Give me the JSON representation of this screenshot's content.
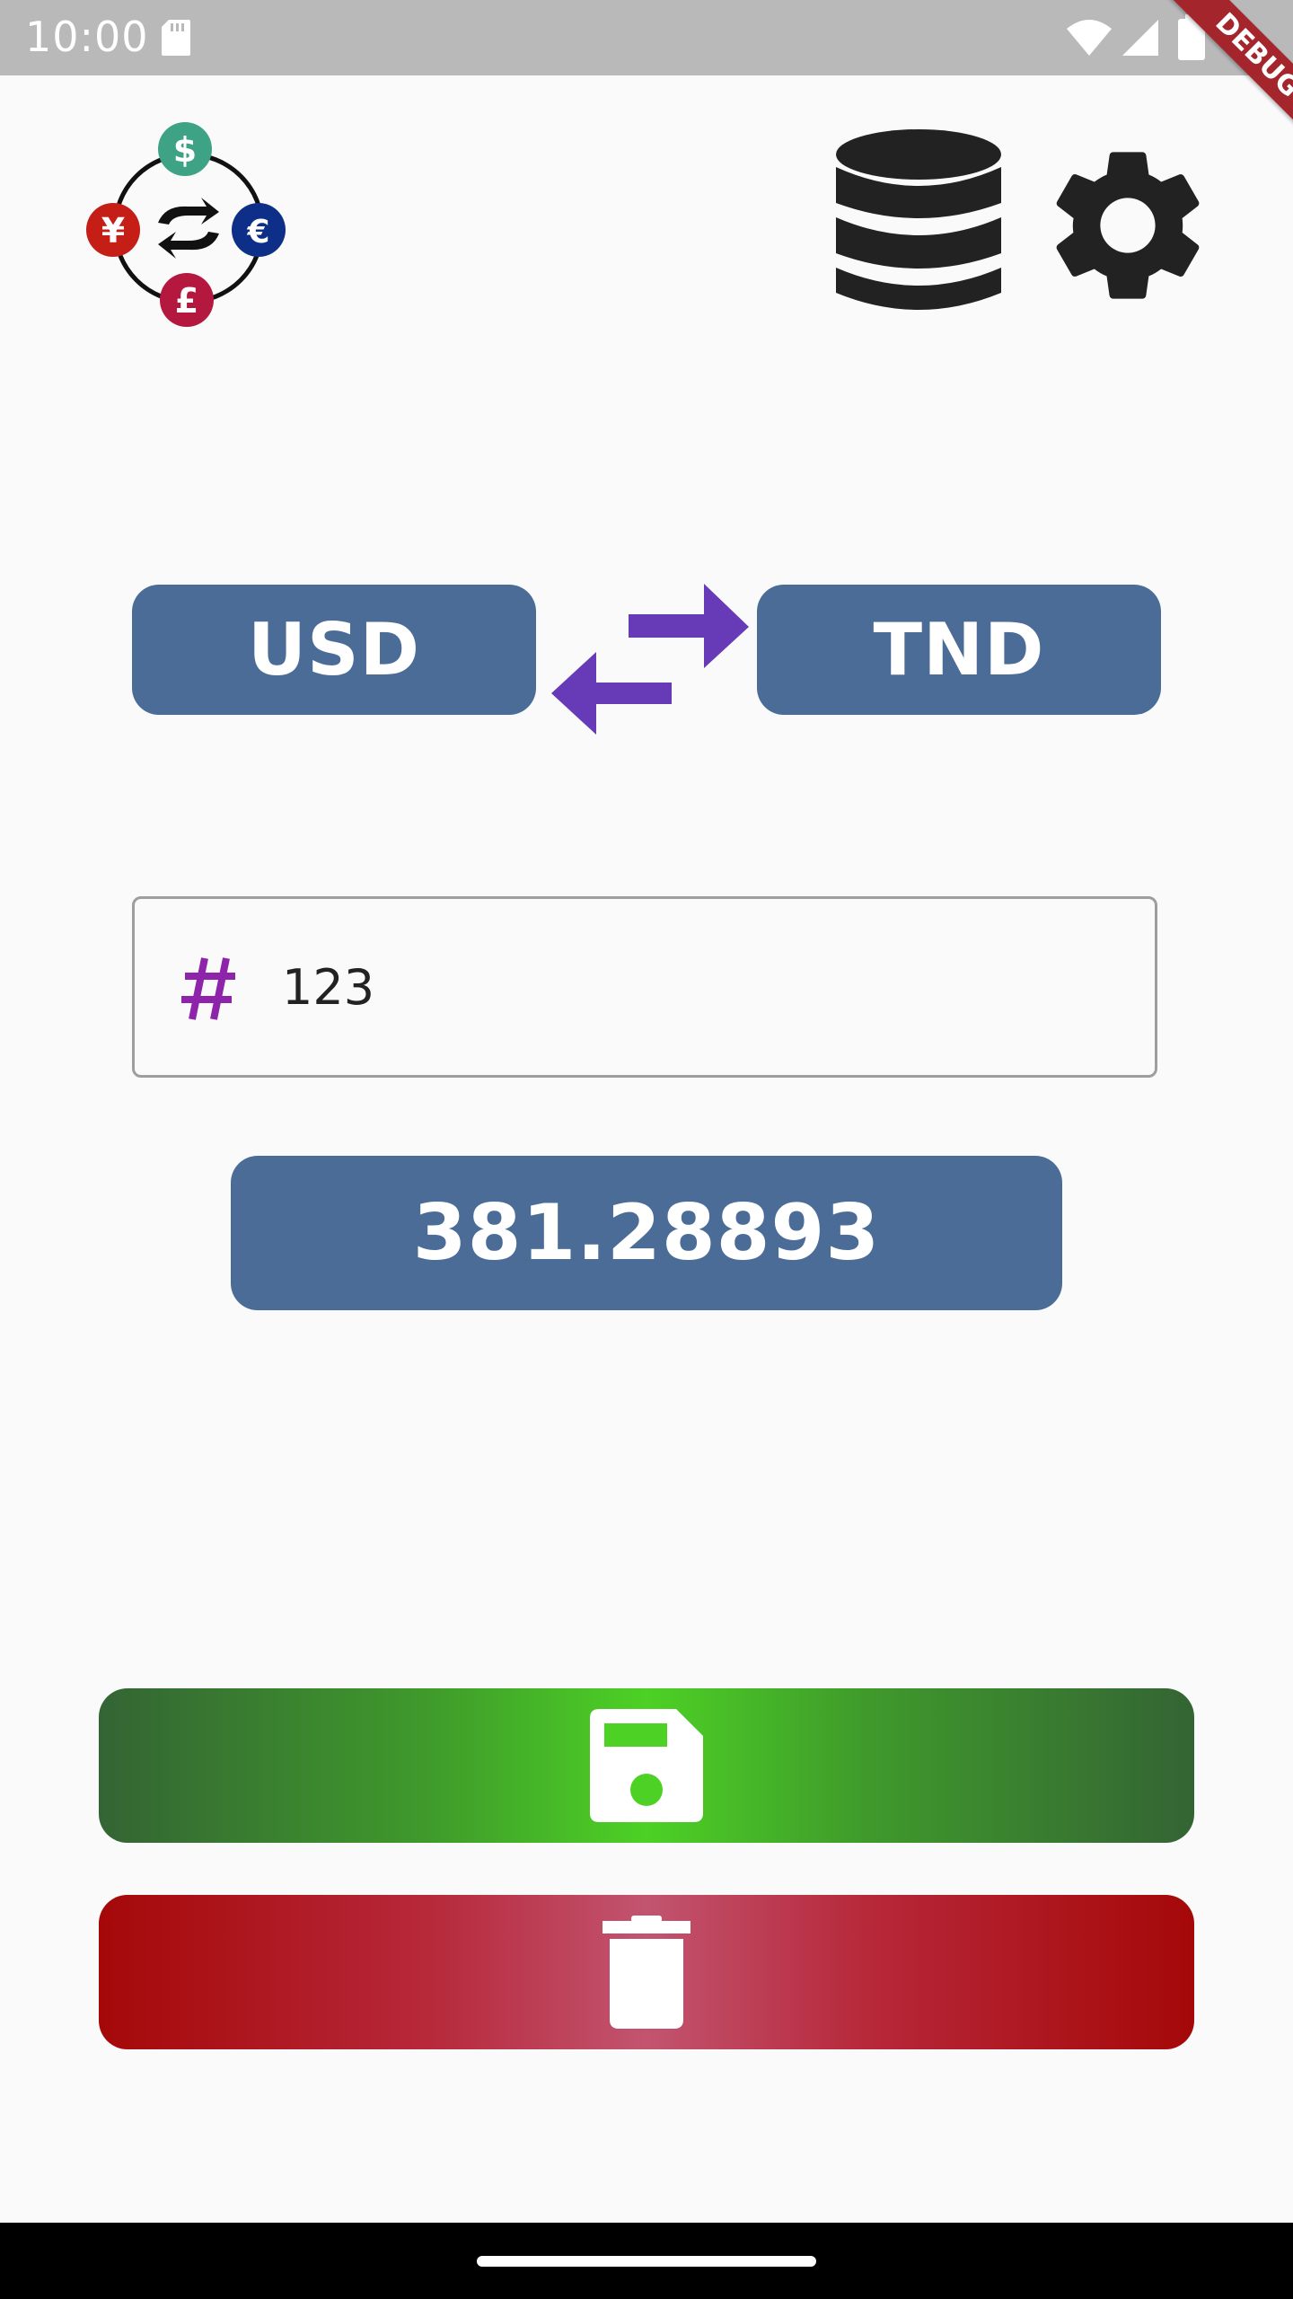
{
  "status_bar": {
    "time": "10:00"
  },
  "debug_banner": {
    "label": "DEBUG"
  },
  "header": {
    "logo_icon": "currency-exchange-logo",
    "database_icon": "database-icon",
    "settings_icon": "gear-icon"
  },
  "converter": {
    "from_currency": "USD",
    "to_currency": "TND",
    "swap_icon": "swap-arrows-icon",
    "amount_prefix_icon": "hash-icon",
    "amount_value": "123",
    "result": "381.28893"
  },
  "actions": {
    "save_icon": "floppy-disk-icon",
    "delete_icon": "trash-icon"
  },
  "colors": {
    "background": "#fafafa",
    "status_bar": "#b9b9b9",
    "currency_button": "#4a6c97",
    "swap_arrows": "#673ab7",
    "hash_icon": "#8e24aa",
    "save_gradient_center": "#4dd125",
    "save_gradient_edge": "#346434",
    "delete_gradient_center": "#c25470",
    "delete_gradient_edge": "#a50808",
    "debug_ribbon": "#a4262c"
  }
}
